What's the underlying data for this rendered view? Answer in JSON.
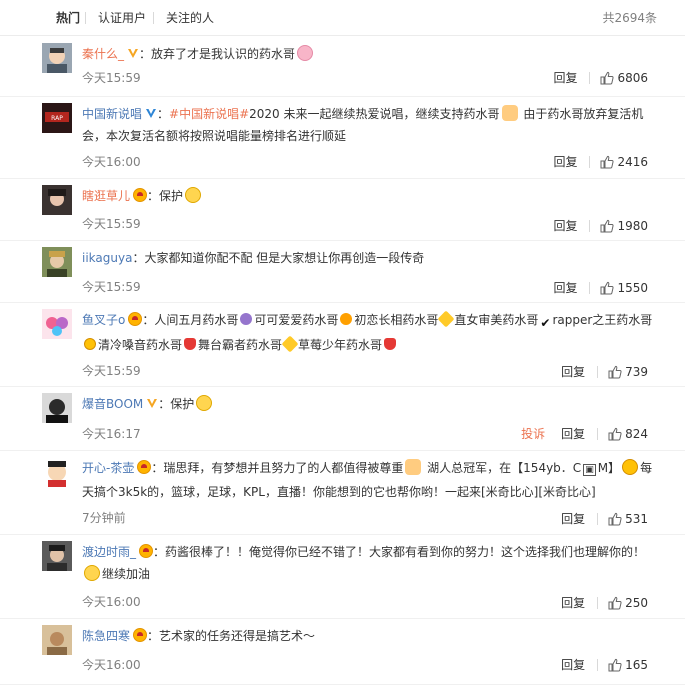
{
  "tabs": [
    {
      "label": "热门"
    },
    {
      "label": "认证用户"
    },
    {
      "label": "关注的人"
    }
  ],
  "total": "共2694条",
  "actions": {
    "reply": "回复",
    "report": "投诉"
  },
  "colors": {
    "username": "#eb7350",
    "verified_blue": "#4d79b5",
    "muted": "#808080"
  },
  "comments": [
    {
      "user": "秦什么_",
      "badge": "orange-v",
      "segs": [
        "：放弃了才是我认识的药水哥"
      ],
      "emoji_names": [
        "pig-icon"
      ],
      "time": "今天15:59",
      "likes": "6806",
      "avatar_color": "#6d7a88"
    },
    {
      "user": "中国新说唱",
      "badge": "blue-v",
      "hashtag": "#中国新说唱#",
      "segs": [
        "：",
        "2020 未来一起继续热爱说唱，继续支持药水哥",
        " 由于药水哥放弃复活机会，本次复活名额将按照说唱能量榜排名进行顺延"
      ],
      "emoji_names": [
        "flex-icon"
      ],
      "time": "今天16:00",
      "likes": "2416",
      "avatar_color": "#3a1f1f"
    },
    {
      "user": "瞎逛草儿",
      "badge": "vip",
      "segs": [
        "：保护"
      ],
      "emoji_names": [
        "cry-icon"
      ],
      "time": "今天15:59",
      "likes": "1980",
      "avatar_color": "#2e2a28"
    },
    {
      "user": "iikaguya",
      "badge": "none",
      "segs": [
        "：大家都知道你配不配 但是大家想让你再创造一段传奇"
      ],
      "time": "今天15:59",
      "likes": "1550",
      "avatar_color": "#8a9a6a"
    },
    {
      "user": "鱼叉子o",
      "badge": "vip",
      "segs": [
        "：人间五月药水哥",
        "可可爱爱药水哥",
        "初恋长相药水哥",
        "直女审美药水哥",
        "rapper之王药水哥",
        "清冷嗓音药水哥",
        "舞台霸者药水哥",
        "草莓少年药水哥"
      ],
      "time": "今天15:59",
      "likes": "739",
      "avatar_color": "#f48fb1"
    },
    {
      "user": "爆音BOOM",
      "badge": "orange-v",
      "segs": [
        "：保护"
      ],
      "emoji_names": [
        "laugh-icon"
      ],
      "time": "今天16:17",
      "likes": "824",
      "report": true,
      "avatar_color": "#1a1a1a"
    },
    {
      "user": "开心-茶壶",
      "badge": "vip",
      "segs": [
        "：瑞思拜，有梦想并且努力了的人都值得被尊重",
        " 湖人总冠军，在【154yb．C",
        "M】",
        "每天搞个3k5k的，篮球，足球，KPL，直播！你能想到的它也帮你哟！一起来[米奇比心][米奇比心]"
      ],
      "time": "7分钟前",
      "likes": "531",
      "avatar_color": "#e57373"
    },
    {
      "user": "渡边时雨_",
      "badge": "vip",
      "segs": [
        "：药酱很棒了！！俺觉得你已经不错了！大家都有看到你的努力！这个选择我们也理解你的！",
        "继续加油"
      ],
      "time": "今天16:00",
      "likes": "250",
      "avatar_color": "#424242"
    },
    {
      "user": "陈急四寒",
      "badge": "vip",
      "segs": [
        "：艺术家的任务还得是搞艺术～"
      ],
      "time": "今天16:00",
      "likes": "165",
      "avatar_color": "#c8a27a"
    }
  ]
}
